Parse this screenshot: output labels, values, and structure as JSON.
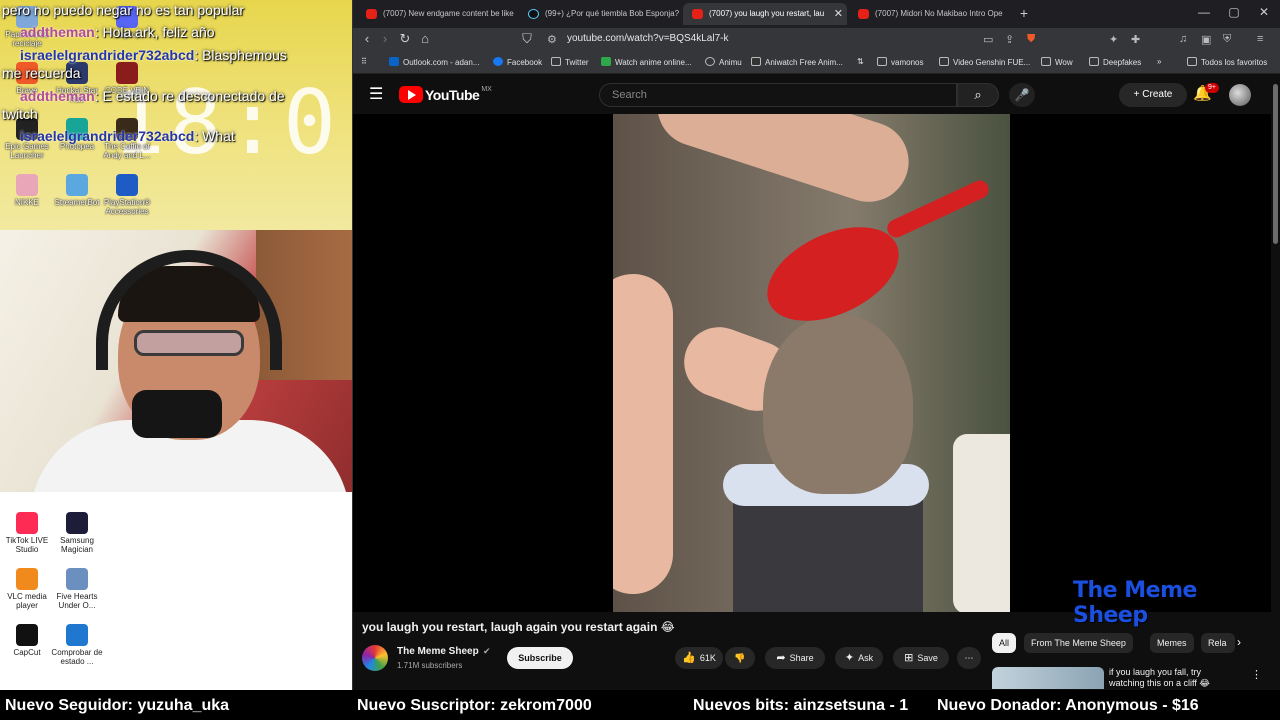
{
  "stream_overlay": {
    "clock": "18:0",
    "chat": [
      {
        "user": "",
        "text": "pero no puedo negar no es tan popular"
      },
      {
        "user": "addtheman",
        "text": "Hola ark, feliz año"
      },
      {
        "user": "israelelgrandrider732abcd",
        "text": "Blasphemous"
      },
      {
        "user": "",
        "text": "me recuerda"
      },
      {
        "user": "addtheman",
        "text": "E estado re desconectado de"
      },
      {
        "user": "",
        "text": "twitch"
      },
      {
        "user": "israelelgrandrider732abcd",
        "text": "What"
      }
    ],
    "desktop_icons_top": [
      {
        "label": "Papelera de reciclaje",
        "color": "#7fa7d9"
      },
      {
        "label": "Legacy",
        "color": "#5865f2"
      },
      {
        "label": "Brave",
        "color": "#f05a28"
      },
      {
        "label": "Honkai Star Rail",
        "color": "#2c3a6b"
      },
      {
        "label": "CODE VEIN",
        "color": "#8a1c1c"
      },
      {
        "label": "Epic Games Launcher",
        "color": "#222222"
      },
      {
        "label": "Photopea",
        "color": "#18a497"
      },
      {
        "label": "The Coffin of Andy and L...",
        "color": "#3a2a1a"
      },
      {
        "label": "NIKKE",
        "color": "#e8a6b8"
      },
      {
        "label": "StreamerBot",
        "color": "#5ba7e0"
      },
      {
        "label": "PlayStation® Accessories",
        "color": "#1f5bc4"
      }
    ],
    "desktop_icons_bottom": [
      {
        "label": "TikTok LIVE Studio",
        "color": "#fe2c55"
      },
      {
        "label": "Samsung Magician",
        "color": "#1d1d3a"
      },
      {
        "label": "VLC media player",
        "color": "#f08a1c"
      },
      {
        "label": "Five Hearts Under O...",
        "color": "#6b8fbf"
      },
      {
        "label": "CapCut",
        "color": "#111111"
      },
      {
        "label": "Comprobar de estado ...",
        "color": "#1f77d0"
      }
    ]
  },
  "browser": {
    "tabs": [
      {
        "title": "(7007) New endgame content be like",
        "icon": "youtube-icon",
        "active": false
      },
      {
        "title": "(99+) ¿Por qué tiembla Bob Esponja?",
        "icon": "tiktok-icon",
        "active": false
      },
      {
        "title": "(7007) you laugh you restart, lau",
        "icon": "youtube-icon",
        "active": true
      },
      {
        "title": "(7007) Midori No Makibao Intro Ope",
        "icon": "youtube-icon",
        "active": false
      }
    ],
    "url": "youtube.com/watch?v=BQS4kLal7-k",
    "bookmarks": [
      "Outlook.com - adan...",
      "Facebook",
      "Twitter",
      "Watch anime online...",
      "Animu",
      "Aniwatch Free Anim...",
      "vamonos",
      "Video Genshin FUE...",
      "Wow",
      "Deepfakes",
      "Todos los favoritos"
    ]
  },
  "youtube": {
    "logo": "YouTube",
    "region": "MX",
    "search_placeholder": "Search",
    "create_label": "Create",
    "notification_count": "9+",
    "video_title": "you laugh you restart, laugh again you restart again 😂",
    "channel_name": "The Meme Sheep",
    "subscribers": "1.71M subscribers",
    "subscribe_label": "Subscribe",
    "likes": "61K",
    "share_label": "Share",
    "ask_label": "Ask",
    "save_label": "Save",
    "watermark": "The Meme Sheep",
    "chips": [
      "All",
      "From The Meme Sheep",
      "Memes",
      "Rela"
    ],
    "recommendation_title": "if you laugh you fall, try watching this on a cliff 😂"
  },
  "ticker": {
    "follower": "Nuevo Seguidor: yuzuha_uka",
    "subscriber": "Nuevo Suscriptor: zekrom7000",
    "bits": "Nuevos bits: ainzsetsuna - 1",
    "donor": "Nuevo Donador: Anonymous - $16"
  },
  "colors": {
    "youtube_red": "#ff0000",
    "ticker_bg": "#000000",
    "overlay_yellow": "#e7d64c",
    "watermark_blue": "#1a4fe0"
  }
}
